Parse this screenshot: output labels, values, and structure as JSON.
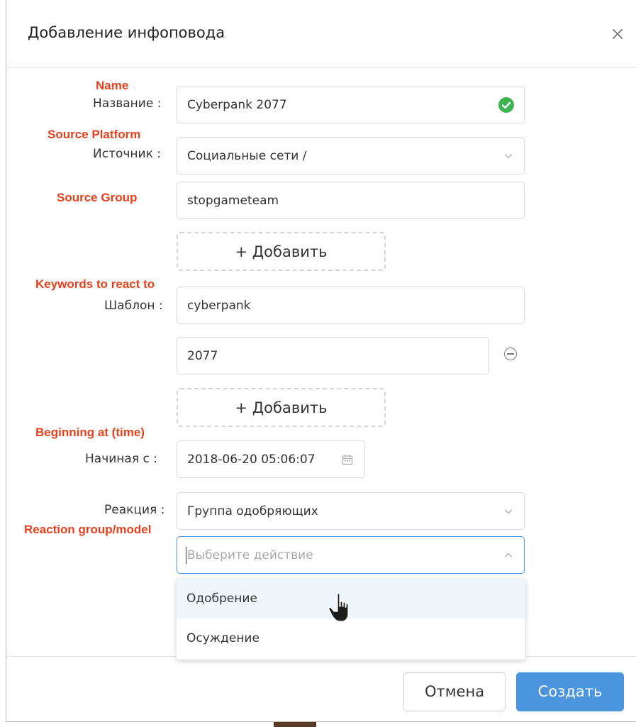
{
  "dialog": {
    "title": "Добавление инфоповода",
    "close_glyph": "×"
  },
  "annotations": {
    "name": "Name",
    "source_platform": "Source Platform",
    "source_group": "Source Group",
    "keywords": "Keywords to react to",
    "beginning": "Beginning at (time)",
    "reaction": "Reaction group/model"
  },
  "form": {
    "name_label": "Название :",
    "name_value": "Cyberpank 2077",
    "source_label": "Источник :",
    "source_value": "Социальные сети /",
    "group_value": "stopgameteam",
    "add_label": "+  Добавить",
    "template_label": "Шаблон :",
    "template_value_1": "cyberpank",
    "template_value_2": "2077",
    "start_label": "Начиная с :",
    "start_value": "2018-06-20 05:06:07",
    "reaction_label": "Реакция :",
    "reaction_value": "Группа одобряющих",
    "action_placeholder": "Выберите действие"
  },
  "dropdown": {
    "options": [
      "Одобрение",
      "Осуждение"
    ]
  },
  "footer": {
    "cancel_label": "Отмена",
    "create_label": "Создать"
  },
  "icons": {
    "valid": "check-circle-icon",
    "select": "chevron-down-icon",
    "select_open": "chevron-up-icon",
    "remove": "minus-circle-icon",
    "calendar": "calendar-icon",
    "cursor": "hand-pointer-icon",
    "close": "close-icon"
  },
  "colors": {
    "annotation": "#e8401c",
    "primary": "#4a95dd",
    "success": "#3cb550",
    "focus_border": "#4d94e0"
  }
}
